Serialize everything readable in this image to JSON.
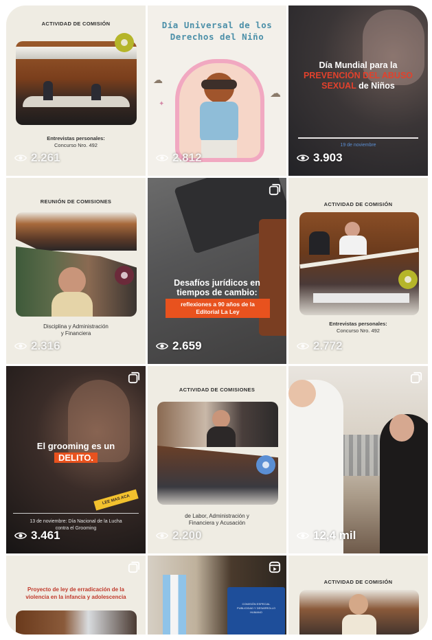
{
  "posts": [
    {
      "id": "p1",
      "header": "ACTIVIDAD DE COMISIÓN",
      "caption_bold": "Entrevistas personales:",
      "caption": "Concurso Nro. 492",
      "views": "2.261"
    },
    {
      "id": "p2",
      "title_line1": "Día Universal de los",
      "title_line2": "Derechos del Niño",
      "views": "2.812"
    },
    {
      "id": "p3",
      "title_line1": "Día Mundial para la",
      "title_red1": "PREVENCIÓN DEL ABUSO",
      "title_red2": "SEXUAL",
      "title_end": " de Niños",
      "date": "19 de noviembre",
      "views": "3.903"
    },
    {
      "id": "p4",
      "header": "REUNIÓN DE COMISIONES",
      "caption_line1": "Disciplina y Administración",
      "caption_line2": "y Financiera",
      "views": "2.316"
    },
    {
      "id": "p5",
      "title_line1": "Desafíos jurídicos en",
      "title_line2": "tiempos de cambio:",
      "ribbon_line1": "reflexiones a 90 años de la",
      "ribbon_line2": "Editorial La Ley",
      "views": "2.659"
    },
    {
      "id": "p6",
      "header": "ACTIVIDAD DE COMISIÓN",
      "caption_bold": "Entrevistas personales:",
      "caption": "Concurso Nro. 492",
      "views": "2.772"
    },
    {
      "id": "p7",
      "title_line1": "El grooming es un",
      "title_highlight": "DELITO.",
      "tag": "LEE MAS ACA",
      "footer_line1": "13 de noviembre: Día Nacional de la Lucha",
      "footer_line2": "contra el Grooming",
      "views": "3.461"
    },
    {
      "id": "p8",
      "header": "ACTIVIDAD DE COMISIONES",
      "caption_line1": "de Labor, Administración y",
      "caption_line2": "Financiera y Acusación",
      "views": "2.200"
    },
    {
      "id": "p9",
      "views": "12,4 mil"
    },
    {
      "id": "p10",
      "title_line1": "Proyecto de ley de erradicación de la",
      "title_line2": "violencia en la infancia y adolescencia"
    },
    {
      "id": "p11",
      "screen_line1": "COMISIÓN ESPECIAL",
      "screen_line2": "PUBLICIDAD Y DESARROLLO",
      "screen_line3": "HUMANO"
    },
    {
      "id": "p12",
      "header": "ACTIVIDAD DE COMISIÓN"
    }
  ],
  "colors": {
    "accent_olive": "#b5b52a",
    "accent_blue": "#5b8fd4",
    "accent_red": "#e2412c",
    "accent_orange": "#e8521e",
    "cream": "#efece3",
    "highlight_yellow": "#f2c12e"
  }
}
